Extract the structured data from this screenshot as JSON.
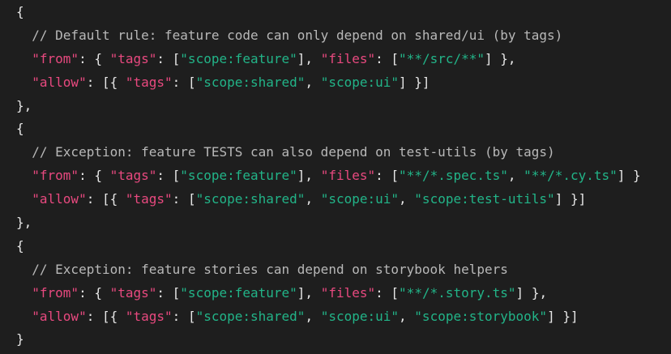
{
  "code": {
    "lines": [
      [
        {
          "t": "{",
          "k": "punct"
        }
      ],
      [
        {
          "t": "  // Default rule: feature code can only depend on shared/ui (by tags)",
          "k": "comment"
        }
      ],
      [
        {
          "t": "  ",
          "k": "punct"
        },
        {
          "t": "\"from\"",
          "k": "key"
        },
        {
          "t": ": { ",
          "k": "punct"
        },
        {
          "t": "\"tags\"",
          "k": "key"
        },
        {
          "t": ": [",
          "k": "punct"
        },
        {
          "t": "\"scope:feature\"",
          "k": "str"
        },
        {
          "t": "], ",
          "k": "punct"
        },
        {
          "t": "\"files\"",
          "k": "key"
        },
        {
          "t": ": [",
          "k": "punct"
        },
        {
          "t": "\"**/src/**\"",
          "k": "str"
        },
        {
          "t": "] },",
          "k": "punct"
        }
      ],
      [
        {
          "t": "  ",
          "k": "punct"
        },
        {
          "t": "\"allow\"",
          "k": "key"
        },
        {
          "t": ": [{ ",
          "k": "punct"
        },
        {
          "t": "\"tags\"",
          "k": "key"
        },
        {
          "t": ": [",
          "k": "punct"
        },
        {
          "t": "\"scope:shared\"",
          "k": "str"
        },
        {
          "t": ", ",
          "k": "punct"
        },
        {
          "t": "\"scope:ui\"",
          "k": "str"
        },
        {
          "t": "] }]",
          "k": "punct"
        }
      ],
      [
        {
          "t": "},",
          "k": "punct"
        }
      ],
      [
        {
          "t": "{",
          "k": "punct"
        }
      ],
      [
        {
          "t": "  // Exception: feature TESTS can also depend on test-utils (by tags)",
          "k": "comment"
        }
      ],
      [
        {
          "t": "  ",
          "k": "punct"
        },
        {
          "t": "\"from\"",
          "k": "key"
        },
        {
          "t": ": { ",
          "k": "punct"
        },
        {
          "t": "\"tags\"",
          "k": "key"
        },
        {
          "t": ": [",
          "k": "punct"
        },
        {
          "t": "\"scope:feature\"",
          "k": "str"
        },
        {
          "t": "], ",
          "k": "punct"
        },
        {
          "t": "\"files\"",
          "k": "key"
        },
        {
          "t": ": [",
          "k": "punct"
        },
        {
          "t": "\"**/*.spec.ts\"",
          "k": "str"
        },
        {
          "t": ", ",
          "k": "punct"
        },
        {
          "t": "\"**/*.cy.ts\"",
          "k": "str"
        },
        {
          "t": "] }",
          "k": "punct"
        }
      ],
      [
        {
          "t": "  ",
          "k": "punct"
        },
        {
          "t": "\"allow\"",
          "k": "key"
        },
        {
          "t": ": [{ ",
          "k": "punct"
        },
        {
          "t": "\"tags\"",
          "k": "key"
        },
        {
          "t": ": [",
          "k": "punct"
        },
        {
          "t": "\"scope:shared\"",
          "k": "str"
        },
        {
          "t": ", ",
          "k": "punct"
        },
        {
          "t": "\"scope:ui\"",
          "k": "str"
        },
        {
          "t": ", ",
          "k": "punct"
        },
        {
          "t": "\"scope:test-utils\"",
          "k": "str"
        },
        {
          "t": "] }]",
          "k": "punct"
        }
      ],
      [
        {
          "t": "},",
          "k": "punct"
        }
      ],
      [
        {
          "t": "{",
          "k": "punct"
        }
      ],
      [
        {
          "t": "  // Exception: feature stories can depend on storybook helpers",
          "k": "comment"
        }
      ],
      [
        {
          "t": "  ",
          "k": "punct"
        },
        {
          "t": "\"from\"",
          "k": "key"
        },
        {
          "t": ": { ",
          "k": "punct"
        },
        {
          "t": "\"tags\"",
          "k": "key"
        },
        {
          "t": ": [",
          "k": "punct"
        },
        {
          "t": "\"scope:feature\"",
          "k": "str"
        },
        {
          "t": "], ",
          "k": "punct"
        },
        {
          "t": "\"files\"",
          "k": "key"
        },
        {
          "t": ": [",
          "k": "punct"
        },
        {
          "t": "\"**/*.story.ts\"",
          "k": "str"
        },
        {
          "t": "] },",
          "k": "punct"
        }
      ],
      [
        {
          "t": "  ",
          "k": "punct"
        },
        {
          "t": "\"allow\"",
          "k": "key"
        },
        {
          "t": ": [{ ",
          "k": "punct"
        },
        {
          "t": "\"tags\"",
          "k": "key"
        },
        {
          "t": ": [",
          "k": "punct"
        },
        {
          "t": "\"scope:shared\"",
          "k": "str"
        },
        {
          "t": ", ",
          "k": "punct"
        },
        {
          "t": "\"scope:ui\"",
          "k": "str"
        },
        {
          "t": ", ",
          "k": "punct"
        },
        {
          "t": "\"scope:storybook\"",
          "k": "str"
        },
        {
          "t": "] }]",
          "k": "punct"
        }
      ],
      [
        {
          "t": "}",
          "k": "punct"
        }
      ]
    ]
  },
  "colors": {
    "background": "#1e1e1e",
    "punctuation": "#e6e6e6",
    "key": "#e8497f",
    "string": "#22b488",
    "comment": "#b8b8b8"
  }
}
